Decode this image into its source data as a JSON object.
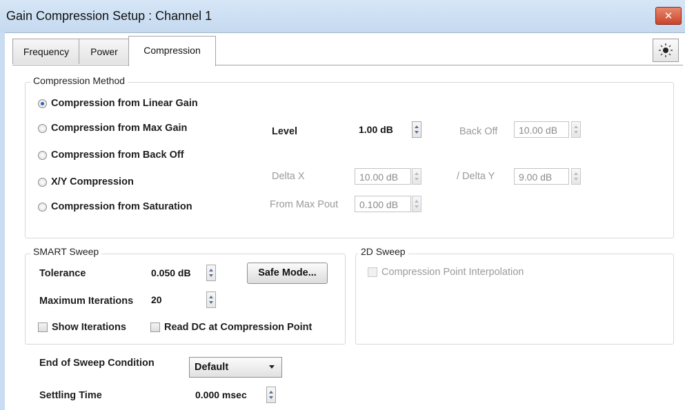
{
  "window": {
    "title": "Gain Compression Setup : Channel 1",
    "close_label": "✕",
    "help_icon": "sun-icon"
  },
  "tabs": [
    {
      "label": "Frequency",
      "active": false
    },
    {
      "label": "Power",
      "active": false
    },
    {
      "label": "Compression",
      "active": true
    }
  ],
  "compression_method": {
    "title": "Compression Method",
    "options": [
      {
        "label": "Compression from Linear Gain",
        "selected": true
      },
      {
        "label": "Compression from Max Gain",
        "selected": false
      },
      {
        "label": "Compression from Back Off",
        "selected": false
      },
      {
        "label": "X/Y Compression",
        "selected": false
      },
      {
        "label": "Compression from Saturation",
        "selected": false
      }
    ],
    "level": {
      "label": "Level",
      "value": "1.00 dB"
    },
    "back_off": {
      "label": "Back Off",
      "value": "10.00 dB"
    },
    "delta_x": {
      "label": "Delta X",
      "value": "10.00 dB"
    },
    "delta_y": {
      "label": "/ Delta Y",
      "value": "9.00 dB"
    },
    "from_max_pout": {
      "label": "From Max Pout",
      "value": "0.100 dB"
    }
  },
  "smart_sweep": {
    "title": "SMART Sweep",
    "tolerance": {
      "label": "Tolerance",
      "value": "0.050 dB"
    },
    "safe_mode_label": "Safe Mode...",
    "max_iterations": {
      "label": "Maximum Iterations",
      "value": "20"
    },
    "show_iterations": {
      "label": "Show Iterations",
      "checked": false
    },
    "read_dc": {
      "label": "Read DC at Compression Point",
      "checked": false
    }
  },
  "sweep_2d": {
    "title": "2D Sweep",
    "interpolation": {
      "label": "Compression Point Interpolation",
      "checked": false,
      "enabled": false
    }
  },
  "end_of_sweep": {
    "label": "End of Sweep Condition",
    "value": "Default"
  },
  "settling_time": {
    "label": "Settling Time",
    "value": "0.000 msec"
  }
}
